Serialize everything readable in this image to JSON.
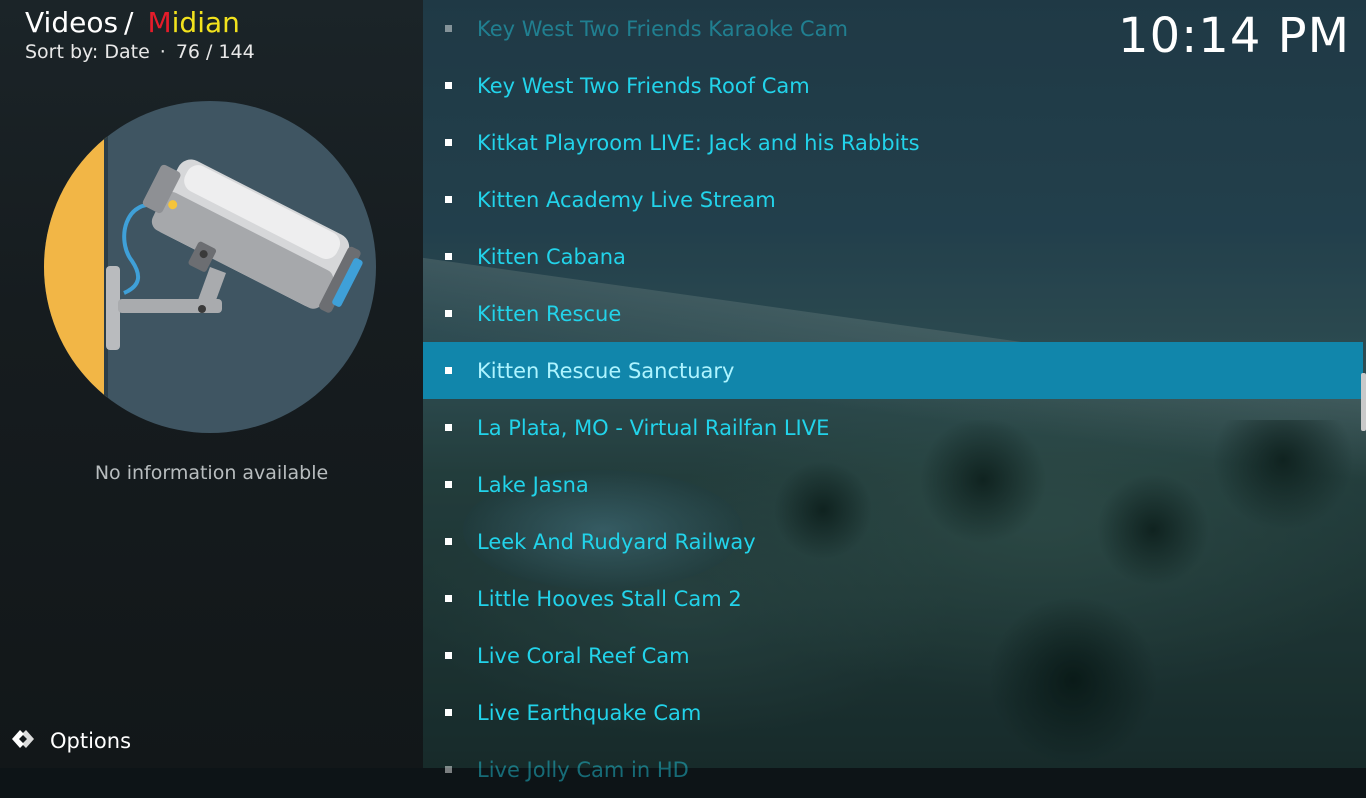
{
  "breadcrumb": {
    "section": "Videos",
    "separator": "/",
    "addon_first_letter": "M",
    "addon_rest": "idian"
  },
  "sort": {
    "label": "Sort by: Date",
    "dot": "·",
    "position": "76 / 144"
  },
  "clock": "10:14 PM",
  "info": "No information available",
  "options_label": "Options",
  "colors": {
    "accent_selected": "#1186ab",
    "item_text": "#22d3ea",
    "addon_red": "#e51c2a",
    "addon_yellow": "#f2e21d"
  },
  "thumbnail_icon": "security-camera-icon",
  "items": [
    {
      "label": "Key West Two Friends Karaoke Cam"
    },
    {
      "label": "Key West Two Friends Roof Cam"
    },
    {
      "label": "Kitkat Playroom LIVE: Jack and his Rabbits"
    },
    {
      "label": "Kitten Academy Live Stream"
    },
    {
      "label": "Kitten Cabana"
    },
    {
      "label": "Kitten Rescue"
    },
    {
      "label": "Kitten Rescue Sanctuary",
      "selected": true
    },
    {
      "label": "La Plata, MO - Virtual Railfan LIVE"
    },
    {
      "label": "Lake Jasna"
    },
    {
      "label": "Leek And Rudyard Railway"
    },
    {
      "label": "Little Hooves Stall Cam 2"
    },
    {
      "label": "Live Coral Reef Cam"
    },
    {
      "label": "Live Earthquake Cam"
    },
    {
      "label": "Live Jolly Cam in HD"
    }
  ]
}
